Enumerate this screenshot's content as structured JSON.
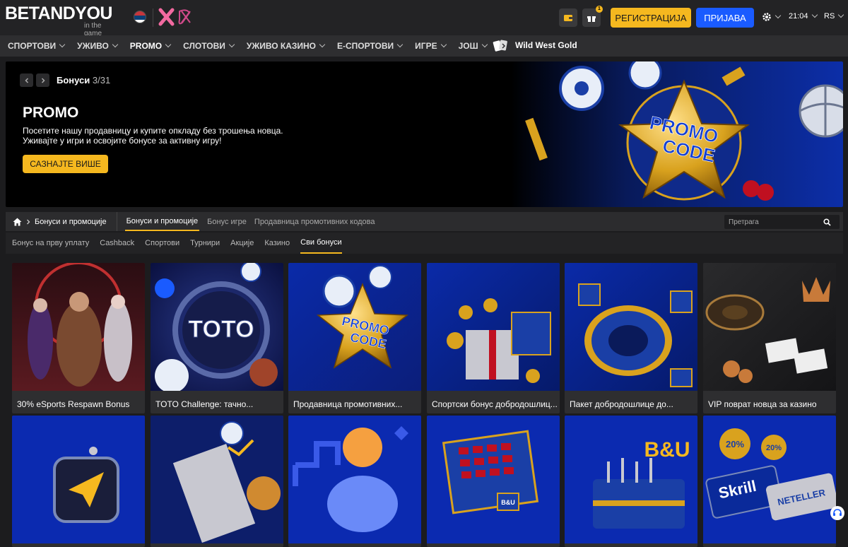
{
  "header": {
    "logo_text": "BETANDYOU",
    "logo_tagline": "in the game",
    "partner_logo": "X",
    "register_label": "РЕГИСТРАЦИЈА",
    "login_label": "ПРИЈАВА",
    "time": "21:04",
    "language": "RS",
    "gift_badge": "1",
    "accent_color": "#f5b81f",
    "login_color": "#1a5bff"
  },
  "nav": {
    "items": [
      {
        "label": "СПОРТОВИ"
      },
      {
        "label": "УЖИВО"
      },
      {
        "label": "PROMO"
      },
      {
        "label": "СЛОТОВИ"
      },
      {
        "label": "УЖИВО КАЗИНО"
      },
      {
        "label": "Е-СПОРТОВИ"
      },
      {
        "label": "ИГРЕ"
      },
      {
        "label": "ЈОШ"
      }
    ],
    "featured": "Wild West Gold"
  },
  "hero": {
    "counter_label": "Бонуси",
    "counter_value": "3/31",
    "title": "PROMO",
    "line1": "Посетите нашу продавницу и купите опкладу без трошења новца.",
    "line2": "Уживајте у игри и освојите бонусе за активну игру!",
    "cta": "САЗНАЈТЕ ВИШЕ",
    "art_text_1": "PROMO",
    "art_text_2": "CODE"
  },
  "tabs": {
    "breadcrumb": "Бонуси и промоције",
    "items": [
      {
        "label": "Бонуси и промоције"
      },
      {
        "label": "Бонус игре"
      },
      {
        "label": "Продавница промотивних кодова"
      }
    ],
    "search_placeholder": "Претрага"
  },
  "subtabs": {
    "items": [
      {
        "label": "Бонус на прву уплату"
      },
      {
        "label": "Cashback"
      },
      {
        "label": "Спортови"
      },
      {
        "label": "Турнири"
      },
      {
        "label": "Акције"
      },
      {
        "label": "Казино"
      },
      {
        "label": "Сви бонуси"
      }
    ]
  },
  "cards": [
    {
      "caption": "30% eSports Respawn Bonus"
    },
    {
      "caption": "TOTO Challenge: тачно..."
    },
    {
      "caption": "Продавница промотивних..."
    },
    {
      "caption": "Спортски бонус добродошлиц..."
    },
    {
      "caption": "Пакет добродошлице до..."
    },
    {
      "caption": "VIP поврат новца за казино"
    }
  ],
  "card_art": {
    "toto": "TOTO",
    "promo": "PROMO",
    "code": "CODE",
    "bu": "B&U",
    "pct": "20%",
    "skrill": "Skrill",
    "neteller": "NETELLER"
  }
}
